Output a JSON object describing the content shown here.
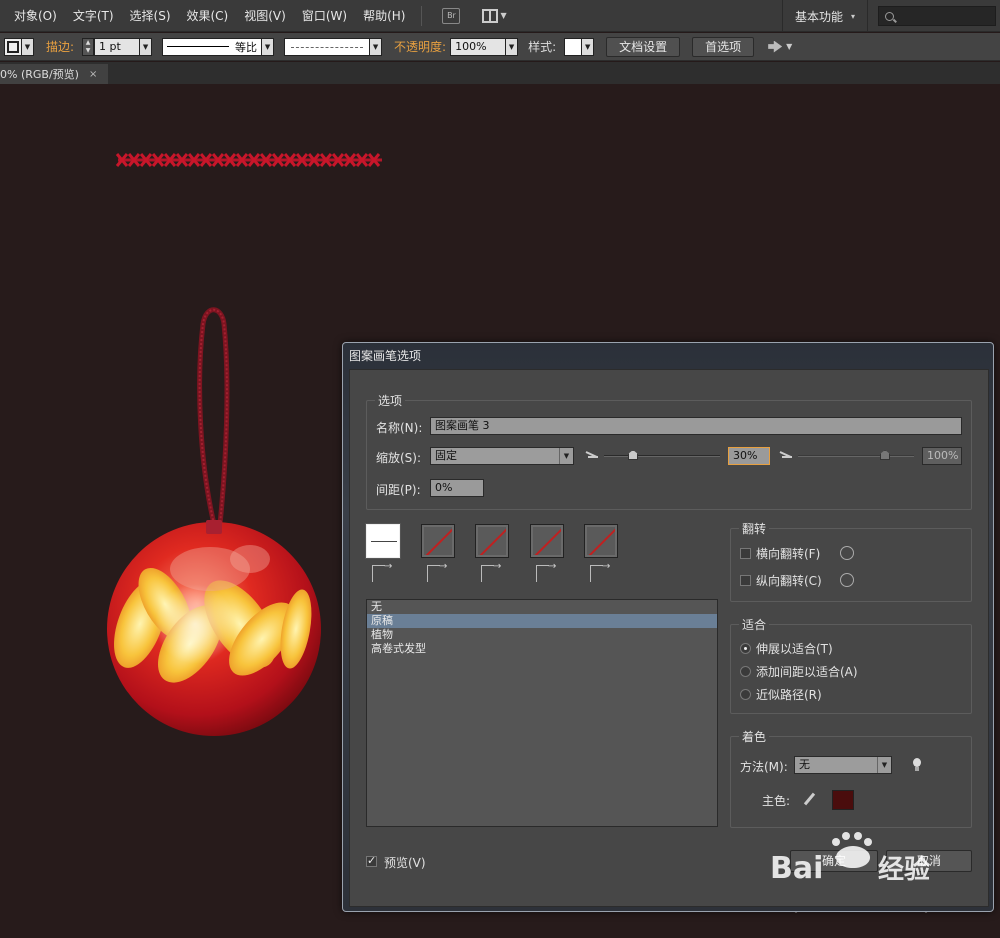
{
  "menubar": {
    "items": [
      "对象(O)",
      "文字(T)",
      "选择(S)",
      "效果(C)",
      "视图(V)",
      "窗口(W)",
      "帮助(H)"
    ],
    "br_label": "Br",
    "workspace": "基本功能",
    "search_placeholder": ""
  },
  "controlbar": {
    "stroke_label": "描边:",
    "stroke_weight": "1 pt",
    "stroke_profile": "等比",
    "opacity_label": "不透明度:",
    "opacity_value": "100%",
    "style_label": "样式:",
    "doc_setup": "文档设置",
    "preferences": "首选项"
  },
  "tab": {
    "title": "0% (RGB/预览)",
    "close": "×"
  },
  "dialog": {
    "title": "图案画笔选项",
    "options_group": "选项",
    "name_label": "名称(N):",
    "name_value": "图案画笔 3",
    "scale_label": "缩放(S):",
    "scale_value": "固定",
    "scale_min_value": "30%",
    "scale_max_value": "100%",
    "scale_min_fraction": 0.25,
    "scale_max_fraction": 0.75,
    "spacing_label": "间距(P):",
    "spacing_value": "0%",
    "tiles": [
      {
        "name": "side",
        "selected": true
      },
      {
        "name": "outer-corner",
        "selected": false
      },
      {
        "name": "inner-corner",
        "selected": false
      },
      {
        "name": "start",
        "selected": false
      },
      {
        "name": "end",
        "selected": false
      }
    ],
    "list_items": [
      "无",
      "原稿",
      "植物",
      "高卷式发型"
    ],
    "selected_list_index": 1,
    "flip_group": "翻转",
    "flip_horizontal": "横向翻转(F)",
    "flip_vertical": "纵向翻转(C)",
    "fit_group": "适合",
    "fit_options": [
      "伸展以适合(T)",
      "添加间距以适合(A)",
      "近似路径(R)"
    ],
    "fit_selected": 0,
    "colorization_group": "着色",
    "method_label": "方法(M):",
    "method_value": "无",
    "key_color_label": "主色:",
    "key_color": "#4a0d0d",
    "preview_label": "预览(V)",
    "ok_label": "确定",
    "cancel_label": "取消"
  },
  "colors": {
    "menubar_bg": "#3a3a3a",
    "canvas_bg": "#271b1b",
    "stroke_accent": "#e8a040",
    "ornament_red": "#c8161d",
    "ornament_gold": "#f5c23c"
  },
  "watermark": {
    "text": "Bai",
    "text2": "经验"
  }
}
